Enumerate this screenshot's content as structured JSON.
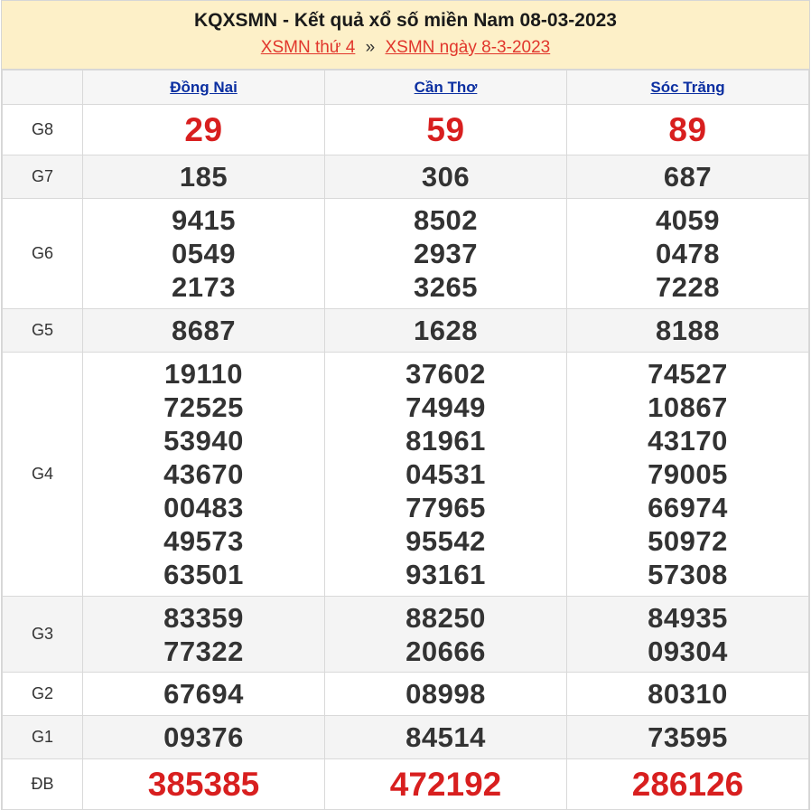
{
  "header": {
    "title": "KQXSMN - Kết quả xổ số miền Nam 08-03-2023",
    "link1": "XSMN thứ 4",
    "separator": "»",
    "link2": "XSMN ngày 8-3-2023"
  },
  "provinces": [
    "Đồng Nai",
    "Cần Thơ",
    "Sóc Trăng"
  ],
  "prizes": [
    {
      "label": "G8",
      "results": [
        [
          "29"
        ],
        [
          "59"
        ],
        [
          "89"
        ]
      ]
    },
    {
      "label": "G7",
      "results": [
        [
          "185"
        ],
        [
          "306"
        ],
        [
          "687"
        ]
      ]
    },
    {
      "label": "G6",
      "results": [
        [
          "9415",
          "0549",
          "2173"
        ],
        [
          "8502",
          "2937",
          "3265"
        ],
        [
          "4059",
          "0478",
          "7228"
        ]
      ]
    },
    {
      "label": "G5",
      "results": [
        [
          "8687"
        ],
        [
          "1628"
        ],
        [
          "8188"
        ]
      ]
    },
    {
      "label": "G4",
      "results": [
        [
          "19110",
          "72525",
          "53940",
          "43670",
          "00483",
          "49573",
          "63501"
        ],
        [
          "37602",
          "74949",
          "81961",
          "04531",
          "77965",
          "95542",
          "93161"
        ],
        [
          "74527",
          "10867",
          "43170",
          "79005",
          "66974",
          "50972",
          "57308"
        ]
      ]
    },
    {
      "label": "G3",
      "results": [
        [
          "83359",
          "77322"
        ],
        [
          "88250",
          "20666"
        ],
        [
          "84935",
          "09304"
        ]
      ]
    },
    {
      "label": "G2",
      "results": [
        [
          "67694"
        ],
        [
          "08998"
        ],
        [
          "80310"
        ]
      ]
    },
    {
      "label": "G1",
      "results": [
        [
          "09376"
        ],
        [
          "84514"
        ],
        [
          "73595"
        ]
      ]
    },
    {
      "label": "ĐB",
      "results": [
        [
          "385385"
        ],
        [
          "472192"
        ],
        [
          "286126"
        ]
      ]
    }
  ],
  "colors": {
    "header_bg": "#fdf0c8",
    "link_red": "#e1362c",
    "province_blue": "#0b2fa1",
    "highlight_red": "#d81f1f"
  }
}
